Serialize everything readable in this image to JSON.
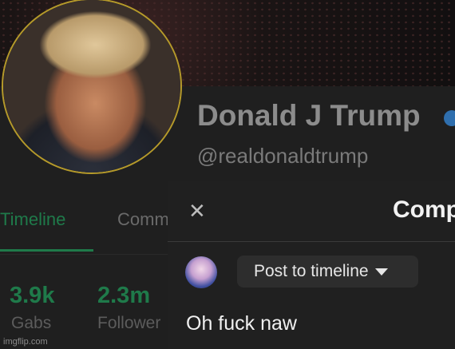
{
  "profile": {
    "display_name": "Donald J Trump",
    "handle": "@realdonaldtrump",
    "verified_icon": "verified-badge-icon",
    "ring_color": "#b59a2a"
  },
  "tabs": [
    {
      "label": "Timeline",
      "active": true
    },
    {
      "label": "Comm",
      "active": false
    }
  ],
  "stats": [
    {
      "value": "3.9k",
      "label": "Gabs"
    },
    {
      "value": "2.3m",
      "label": "Follower"
    }
  ],
  "compose": {
    "title": "Comp",
    "close_icon": "close-icon",
    "audience": "Post to timeline",
    "text": "Oh fuck naw"
  },
  "colors": {
    "accent": "#1f7a4a",
    "background": "#1f1f1f",
    "modal": "#202020"
  },
  "watermark": "imgflip.com"
}
